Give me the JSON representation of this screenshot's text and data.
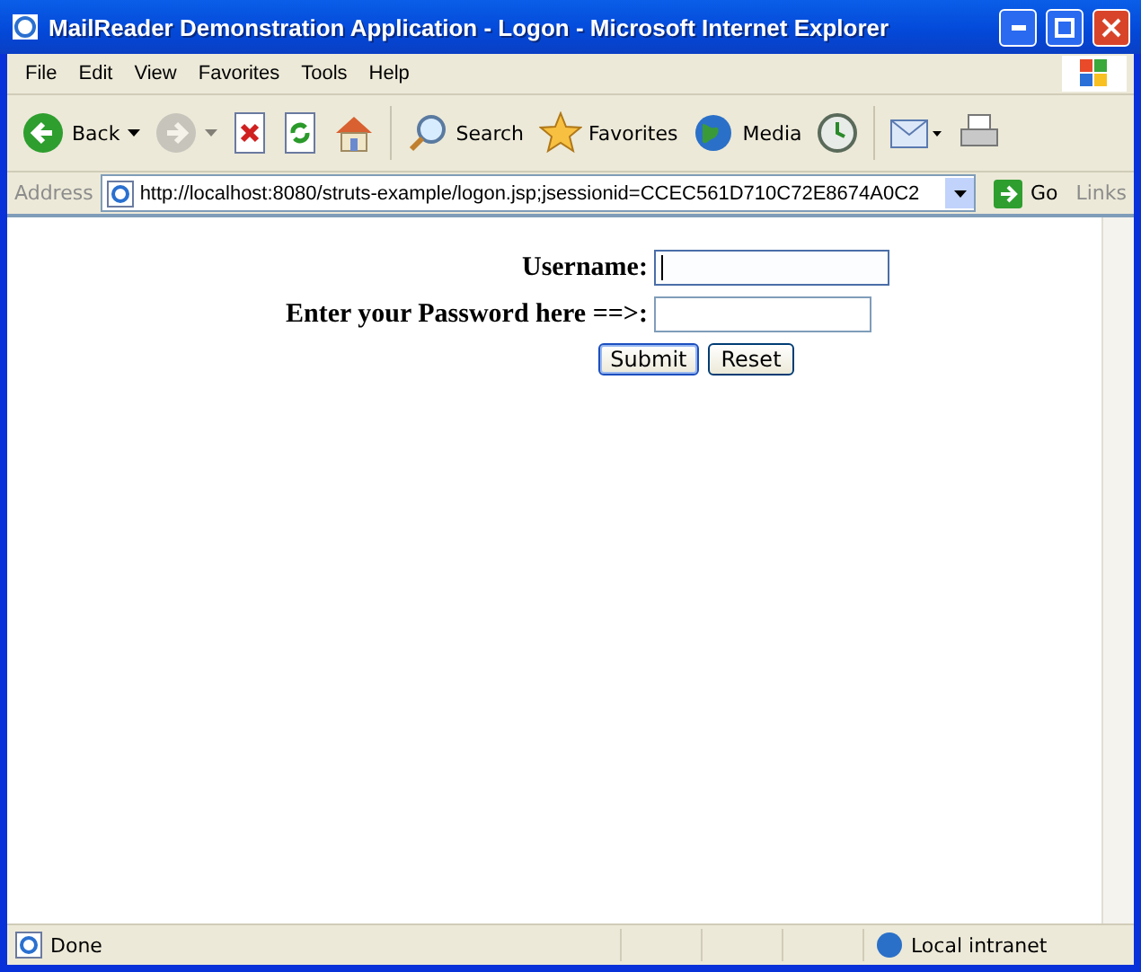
{
  "window": {
    "title": "MailReader Demonstration Application - Logon - Microsoft Internet Explorer"
  },
  "menu": [
    {
      "label": "File"
    },
    {
      "label": "Edit"
    },
    {
      "label": "View"
    },
    {
      "label": "Favorites"
    },
    {
      "label": "Tools"
    },
    {
      "label": "Help"
    }
  ],
  "toolbar": [
    {
      "kind": "back",
      "label": "Back",
      "disabled": false
    },
    {
      "kind": "forward",
      "disabled": true
    },
    {
      "kind": "stop"
    },
    {
      "kind": "refresh"
    },
    {
      "kind": "home"
    },
    {
      "kind": "search",
      "label": "Search"
    },
    {
      "kind": "favorites",
      "label": "Favorites"
    },
    {
      "kind": "media",
      "label": "Media"
    },
    {
      "kind": "history"
    },
    {
      "kind": "mail"
    },
    {
      "kind": "print"
    }
  ],
  "address_bar": {
    "label": "Address",
    "url": "http://localhost:8080/struts-example/logon.jsp;jsessionid=CCEC561D710C72E8674A0C2",
    "go": "Go",
    "links": "Links"
  },
  "form": {
    "fields": [
      {
        "label": "Username:",
        "kind": "text",
        "focused": true
      },
      {
        "label": "Enter your Password here ==>:",
        "kind": "password",
        "focused": false
      }
    ],
    "buttons": [
      {
        "label": "Submit",
        "default": true
      },
      {
        "label": "Reset",
        "default": false
      }
    ]
  },
  "status_bar": {
    "text": "Done",
    "zone": "Local intranet"
  }
}
